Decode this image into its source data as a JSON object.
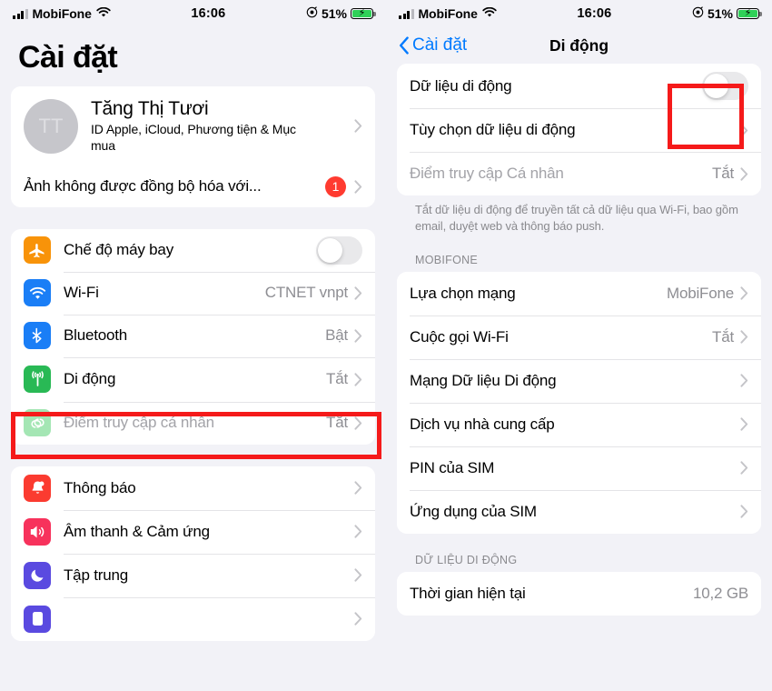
{
  "left": {
    "statusbar": {
      "carrier": "MobiFone",
      "wifi_icon": "wifi-icon",
      "time": "16:06",
      "battery_pct": "51%",
      "focus_icon": "focus-mode-icon",
      "charging_icon": "charging-bolt-icon"
    },
    "title": "Cài đặt",
    "profile": {
      "initials": "TT",
      "name": "Tăng Thị Tươi",
      "subtitle": "ID Apple, iCloud, Phương tiện & Mục mua",
      "alert_label": "Ảnh không được đồng bộ hóa với...",
      "alert_badge": "1"
    },
    "group_connectivity": [
      {
        "icon": "airplane-icon",
        "label": "Chế độ máy bay",
        "control": "toggle",
        "toggle_on": false,
        "value": "",
        "dim": false
      },
      {
        "icon": "wifi-icon",
        "label": "Wi-Fi",
        "control": "chevron",
        "value": "CTNET vnpt",
        "dim": false
      },
      {
        "icon": "bluetooth-icon",
        "label": "Bluetooth",
        "control": "chevron",
        "value": "Bật",
        "dim": false
      },
      {
        "icon": "cellular-icon",
        "label": "Di động",
        "control": "chevron",
        "value": "Tắt",
        "dim": false,
        "highlighted": true
      },
      {
        "icon": "hotspot-icon",
        "label": "Điểm truy cập cá nhân",
        "control": "chevron",
        "value": "Tắt",
        "dim": true
      }
    ],
    "group_alerts": [
      {
        "icon": "notification-bell-icon",
        "label": "Thông báo",
        "control": "chevron",
        "value": ""
      },
      {
        "icon": "sound-speaker-icon",
        "label": "Âm thanh & Cảm ứng",
        "control": "chevron",
        "value": ""
      },
      {
        "icon": "focus-moon-icon",
        "label": "Tập trung",
        "control": "chevron",
        "value": ""
      },
      {
        "icon": "screentime-icon",
        "label": "",
        "control": "chevron",
        "value": ""
      }
    ]
  },
  "right": {
    "statusbar": {
      "carrier": "MobiFone",
      "wifi_icon": "wifi-icon",
      "time": "16:06",
      "battery_pct": "51%",
      "focus_icon": "focus-mode-icon",
      "charging_icon": "charging-bolt-icon"
    },
    "nav": {
      "back_label": "Cài đặt",
      "title": "Di động"
    },
    "group_data": [
      {
        "label": "Dữ liệu di động",
        "control": "toggle",
        "toggle_on": false,
        "value": "",
        "dim": false,
        "highlighted": true
      },
      {
        "label": "Tùy chọn dữ liệu di động",
        "control": "chevron",
        "value": "",
        "dim": false
      },
      {
        "label": "Điểm truy cập Cá nhân",
        "control": "chevron",
        "value": "Tắt",
        "dim": true
      }
    ],
    "data_footer": "Tắt dữ liệu di động để truyền tất cả dữ liệu qua Wi-Fi, bao gồm email, duyệt web và thông báo push.",
    "carrier_header": "MOBIFONE",
    "group_carrier": [
      {
        "label": "Lựa chọn mạng",
        "value": "MobiFone",
        "control": "chevron"
      },
      {
        "label": "Cuộc gọi Wi-Fi",
        "value": "Tắt",
        "control": "chevron"
      },
      {
        "label": "Mạng Dữ liệu Di động",
        "value": "",
        "control": "chevron"
      },
      {
        "label": "Dịch vụ nhà cung cấp",
        "value": "",
        "control": "chevron"
      },
      {
        "label": "PIN của SIM",
        "value": "",
        "control": "chevron"
      },
      {
        "label": "Ứng dụng của SIM",
        "value": "",
        "control": "chevron"
      }
    ],
    "usage_header": "DỮ LIỆU DI ĐỘNG",
    "group_usage": [
      {
        "label": "Thời gian hiện tại",
        "value": "10,2 GB",
        "control": "none"
      }
    ]
  },
  "colors": {
    "accent_blue": "#007aff",
    "annotation_red": "#f51a1a",
    "badge_red": "#ff3b30",
    "page_bg": "#f2f2f7",
    "card_bg": "#ffffff",
    "secondary_text": "#8e8e93",
    "battery_green": "#2fd158"
  }
}
